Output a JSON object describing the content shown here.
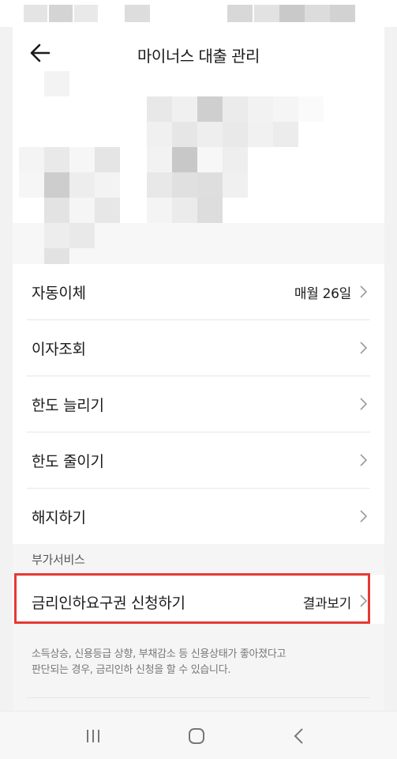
{
  "header": {
    "title": "마이너스 대출 관리"
  },
  "menu": [
    {
      "label": "자동이체",
      "value": "매월 26일"
    },
    {
      "label": "이자조회",
      "value": ""
    },
    {
      "label": "한도 늘리기",
      "value": ""
    },
    {
      "label": "한도 줄이기",
      "value": ""
    },
    {
      "label": "해지하기",
      "value": ""
    }
  ],
  "extra_services": {
    "section_label": "부가서비스",
    "item": {
      "label": "금리인하요구권 신청하기",
      "value": "결과보기"
    },
    "note": "소득상승, 신용등급 상향, 부채감소 등 신용상태가 좋아졌다고\n판단되는 경우, 금리인하 신청을 할 수 있습니다."
  },
  "colors": {
    "highlight": "#e53935",
    "text": "#1a1a1a",
    "muted": "#777777"
  }
}
